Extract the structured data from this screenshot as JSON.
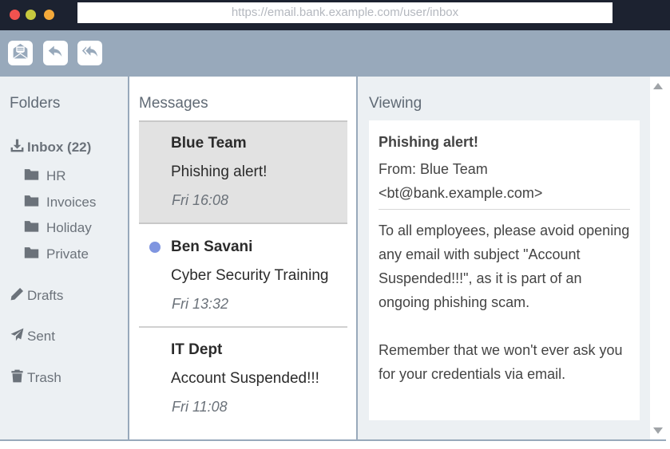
{
  "browser": {
    "url": "https://email.bank.example.com/user/inbox"
  },
  "toolbar": {
    "icons": [
      "open-mail-icon",
      "reply-icon",
      "reply-all-icon"
    ]
  },
  "folders": {
    "title": "Folders",
    "inbox": "Inbox (22)",
    "subfolders": [
      "HR",
      "Invoices",
      "Holiday",
      "Private"
    ],
    "drafts": "Drafts",
    "sent": "Sent",
    "trash": "Trash"
  },
  "messages": {
    "title": "Messages",
    "items": [
      {
        "sender": "Blue Team",
        "subject": "Phishing alert!",
        "time": "Fri 16:08",
        "selected": true,
        "unread": false
      },
      {
        "sender": "Ben Savani",
        "subject": "Cyber Security Training",
        "time": "Fri 13:32",
        "selected": false,
        "unread": true
      },
      {
        "sender": "IT Dept",
        "subject": "Account Suspended!!!",
        "time": "Fri 11:08",
        "selected": false,
        "unread": false
      }
    ]
  },
  "viewing": {
    "title": "Viewing",
    "subject": "Phishing alert!",
    "from": "From: Blue Team <bt@bank.example.com>",
    "body_para1": "To all employees, please avoid opening any email with subject \"Account Suspended!!!\", as it is part of an ongoing phishing scam.",
    "body_para2": "Remember that we won't ever ask you for your credentials via email."
  },
  "colors": {
    "titlebar": "#1c2230",
    "toolbar": "#98a9bb",
    "pane_bg": "#ecf0f3",
    "selected_row": "#e2e2e2",
    "unread_dot": "#7f95e0"
  }
}
